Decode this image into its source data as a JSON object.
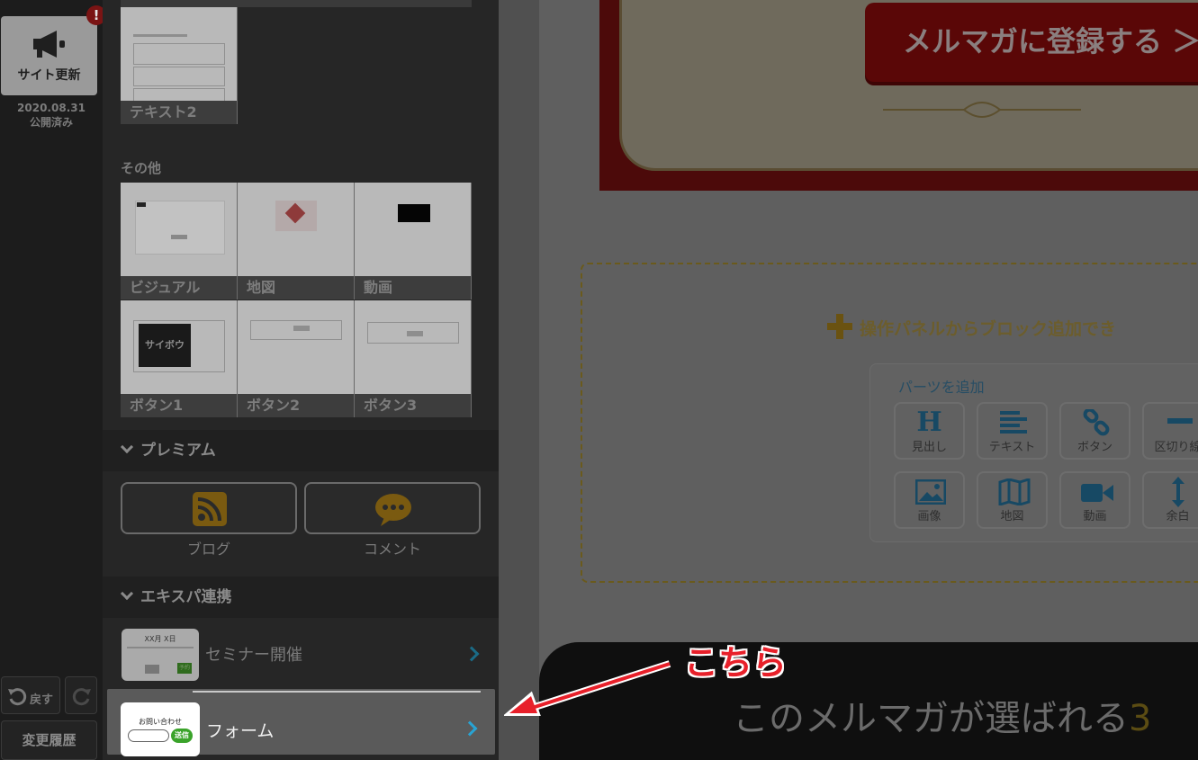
{
  "rail": {
    "publish_label": "サイト更新",
    "alert_mark": "!",
    "publish_date": "2020.08.31",
    "publish_status": "公開済み",
    "undo_label": "戻す",
    "history_label": "変更履歴"
  },
  "panel": {
    "top_tiles": [
      {
        "label": "テキスト2"
      }
    ],
    "other_section": "その他",
    "other_tiles": [
      {
        "label": "ビジュアル"
      },
      {
        "label": "地図"
      },
      {
        "label": "動画"
      },
      {
        "label": "ボタン1",
        "thumb_text": "サイボウ"
      },
      {
        "label": "ボタン2"
      },
      {
        "label": "ボタン3"
      }
    ],
    "premium_section": "プレミアム",
    "premium_items": [
      {
        "label": "ブログ",
        "icon": "rss-icon"
      },
      {
        "label": "コメント",
        "icon": "speech-bubble-icon"
      }
    ],
    "expa_section": "エキスパ連携",
    "expa_items": [
      {
        "label": "セミナー開催",
        "thumb_title": "XX月 X日",
        "thumb_button": "予約"
      },
      {
        "label": "フォーム",
        "thumb_title": "お問い合わせ",
        "thumb_button": "送信"
      }
    ]
  },
  "canvas": {
    "cta_label": "メルマガに登録する ＞",
    "add_block_message": "操作パネルからブロック追加でき",
    "parts_title": "パーツを追加",
    "parts": [
      {
        "label": "見出し",
        "icon": "heading-icon"
      },
      {
        "label": "テキスト",
        "icon": "text-lines-icon"
      },
      {
        "label": "ボタン",
        "icon": "link-icon"
      },
      {
        "label": "区切り線",
        "icon": "divider-icon"
      },
      {
        "label": "画像",
        "icon": "image-icon"
      },
      {
        "label": "地図",
        "icon": "map-icon"
      },
      {
        "label": "動画",
        "icon": "video-icon"
      },
      {
        "label": "余白",
        "icon": "vertical-space-icon"
      }
    ],
    "bottom_text": "このメルマガが選ばれる",
    "bottom_accent": "3"
  },
  "annotation": {
    "text": "こちら",
    "color": "#e8202a"
  },
  "colors": {
    "accent_blue": "#28a3d3",
    "alert_red": "#7a1414",
    "banner_red": "#5a0707"
  }
}
